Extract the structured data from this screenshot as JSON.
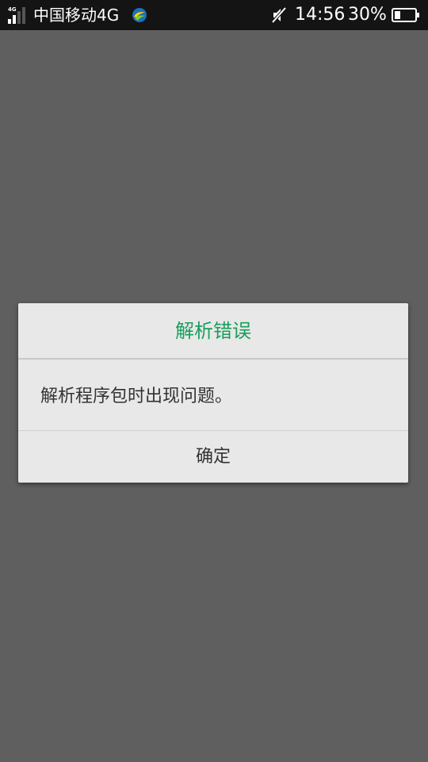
{
  "status_bar": {
    "network_type": "4G",
    "carrier": "中国移动4G",
    "time": "14:56",
    "battery_percent": "30%",
    "battery_level": 0.3,
    "icons": [
      "signal-icon",
      "china-mobile-logo-icon",
      "mute-icon",
      "battery-icon"
    ]
  },
  "dialog": {
    "title": "解析错误",
    "message": "解析程序包时出现问题。",
    "ok_label": "确定"
  },
  "colors": {
    "title_accent": "#1a9e5c",
    "scrim": "#5f5f5f",
    "status_bar": "#141414",
    "dialog_bg": "#e8e8e8"
  }
}
